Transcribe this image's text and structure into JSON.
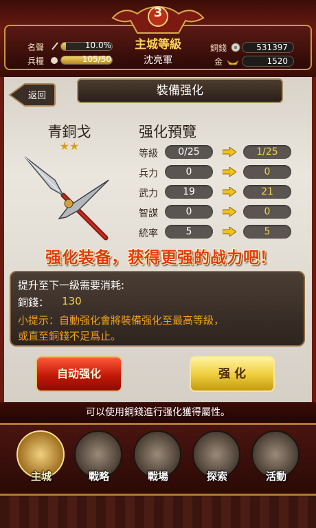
{
  "header": {
    "level_badge": "3",
    "level_title": "主城等級",
    "player_name": "沈亮軍",
    "fame_label": "名聲",
    "fame_value": "10.0%",
    "fame_fill": 0.1,
    "food_label": "兵糧",
    "food_value": "105/50",
    "food_fill": 1.0,
    "copper_label": "銅錢",
    "copper_value": "531397",
    "gold_label": "金",
    "gold_value": "1520"
  },
  "panel": {
    "back_label": "返回",
    "title": "裝備强化",
    "item_name": "青銅戈",
    "item_stars": "★★",
    "preview_title": "强化預覽",
    "stats": [
      {
        "label": "等級",
        "current": "0/25",
        "next": "1/25"
      },
      {
        "label": "兵力",
        "current": "0",
        "next": "0"
      },
      {
        "label": "武力",
        "current": "19",
        "next": "21"
      },
      {
        "label": "智謀",
        "current": "0",
        "next": "0"
      },
      {
        "label": "統率",
        "current": "5",
        "next": "5"
      }
    ],
    "slogan": "强化装备，获得更强的战力吧！",
    "cost_line": "提升至下一級需要消耗:",
    "cost_label": "銅錢：",
    "cost_value": "130",
    "tip_line1": "小提示：自動强化會將裝備强化至最高等級，",
    "tip_line2": "或直至銅錢不足爲止。",
    "auto_button": "自动强化",
    "enhance_button": "强 化"
  },
  "status_text": "可以使用銅錢進行强化獲得屬性。",
  "nav": [
    {
      "label": "主城",
      "icon": "palace-icon"
    },
    {
      "label": "戰略",
      "icon": "helmet-icon"
    },
    {
      "label": "戰場",
      "icon": "crossed-swords-icon"
    },
    {
      "label": "探索",
      "icon": "scout-icon"
    },
    {
      "label": "活動",
      "icon": "treasure-chest-icon"
    }
  ],
  "colors": {
    "accent_red": "#e23a10",
    "gold": "#f6d34a",
    "tip_orange": "#f0a020"
  }
}
